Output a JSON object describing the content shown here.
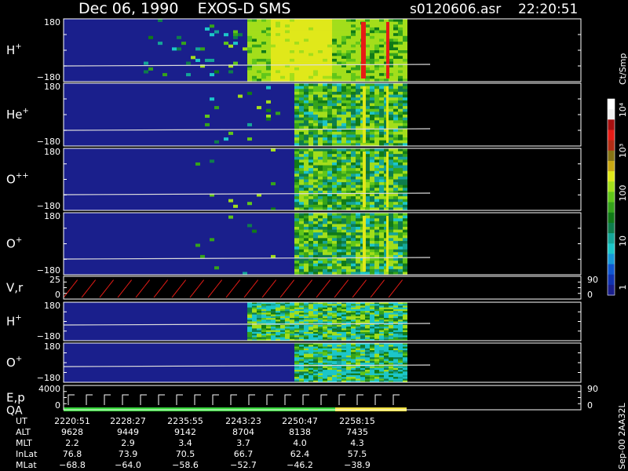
{
  "header": {
    "title": "Dec 06, 1990    EXOS-D SMS",
    "file": "s0120606.asr",
    "time": "22:20:51"
  },
  "colorbar": {
    "unit_label": "Ct/Smp",
    "tick_labels": [
      "10⁴",
      "10³",
      "100",
      "10",
      "1"
    ],
    "tick_values": [
      10000,
      1000,
      100,
      10,
      1
    ],
    "colors": [
      "#1a1f8c",
      "#1133b0",
      "#1157d0",
      "#1899d8",
      "#1cc6c9",
      "#15a598",
      "#0e7d4c",
      "#117a18",
      "#35a31b",
      "#61c61a",
      "#a3de1b",
      "#e0e81a",
      "#c9a813",
      "#877414",
      "#b32d15",
      "#e61c16",
      "#a61010",
      "#f0f0f0",
      "#ffffff"
    ]
  },
  "chart_data": {
    "type": "heatmap",
    "title": "Dec 06, 1990    EXOS-D SMS",
    "x_ticks": [
      "2220:51",
      "2228:27",
      "2235:55",
      "2243:23",
      "2250:47",
      "2258:15"
    ],
    "panels": [
      {
        "label": "H",
        "charge": "+",
        "ylim": [
          -180,
          180
        ],
        "tick_top": "180",
        "tick_bottom": "−180"
      },
      {
        "label": "He",
        "charge": "+",
        "ylim": [
          -180,
          180
        ],
        "tick_top": "180",
        "tick_bottom": "−180"
      },
      {
        "label": "O",
        "charge": "++",
        "ylim": [
          -180,
          180
        ],
        "tick_top": "180",
        "tick_bottom": "−180"
      },
      {
        "label": "O",
        "charge": "+",
        "ylim": [
          -180,
          180
        ],
        "tick_top": "180",
        "tick_bottom": "−180"
      },
      {
        "label": "V,r",
        "charge": "",
        "ylim": [
          0,
          25
        ],
        "tick_top": "25",
        "tick_bottom": "0",
        "right_top": "90",
        "right_bottom": "0"
      },
      {
        "label": "H",
        "charge": "+",
        "ylim": [
          -180,
          180
        ],
        "tick_top": "180",
        "tick_bottom": "−180"
      },
      {
        "label": "O",
        "charge": "+",
        "ylim": [
          -180,
          180
        ],
        "tick_top": "180",
        "tick_bottom": "−180"
      },
      {
        "label": "E,p",
        "charge": "",
        "label2": "QA",
        "ylim": [
          0,
          4000
        ],
        "tick_top": "4000",
        "tick_bottom": "0",
        "right_top": "90",
        "right_bottom": "0"
      }
    ],
    "ephemeris": [
      {
        "name": "UT",
        "values": [
          "2220:51",
          "2228:27",
          "2235:55",
          "2243:23",
          "2250:47",
          "2258:15"
        ]
      },
      {
        "name": "ALT",
        "values": [
          "9628",
          "9449",
          "9142",
          "8704",
          "8138",
          "7435"
        ]
      },
      {
        "name": "MLT",
        "values": [
          "2.2",
          "2.9",
          "3.4",
          "3.7",
          "4.0",
          "4.3"
        ]
      },
      {
        "name": "InLat",
        "values": [
          "76.8",
          "73.9",
          "70.5",
          "66.7",
          "62.4",
          "57.5"
        ]
      },
      {
        "name": "MLat",
        "values": [
          "−68.8",
          "−64.0",
          "−58.6",
          "−52.7",
          "−46.2",
          "−38.9"
        ]
      }
    ]
  },
  "side_note": "Sep-00  2AA32L"
}
